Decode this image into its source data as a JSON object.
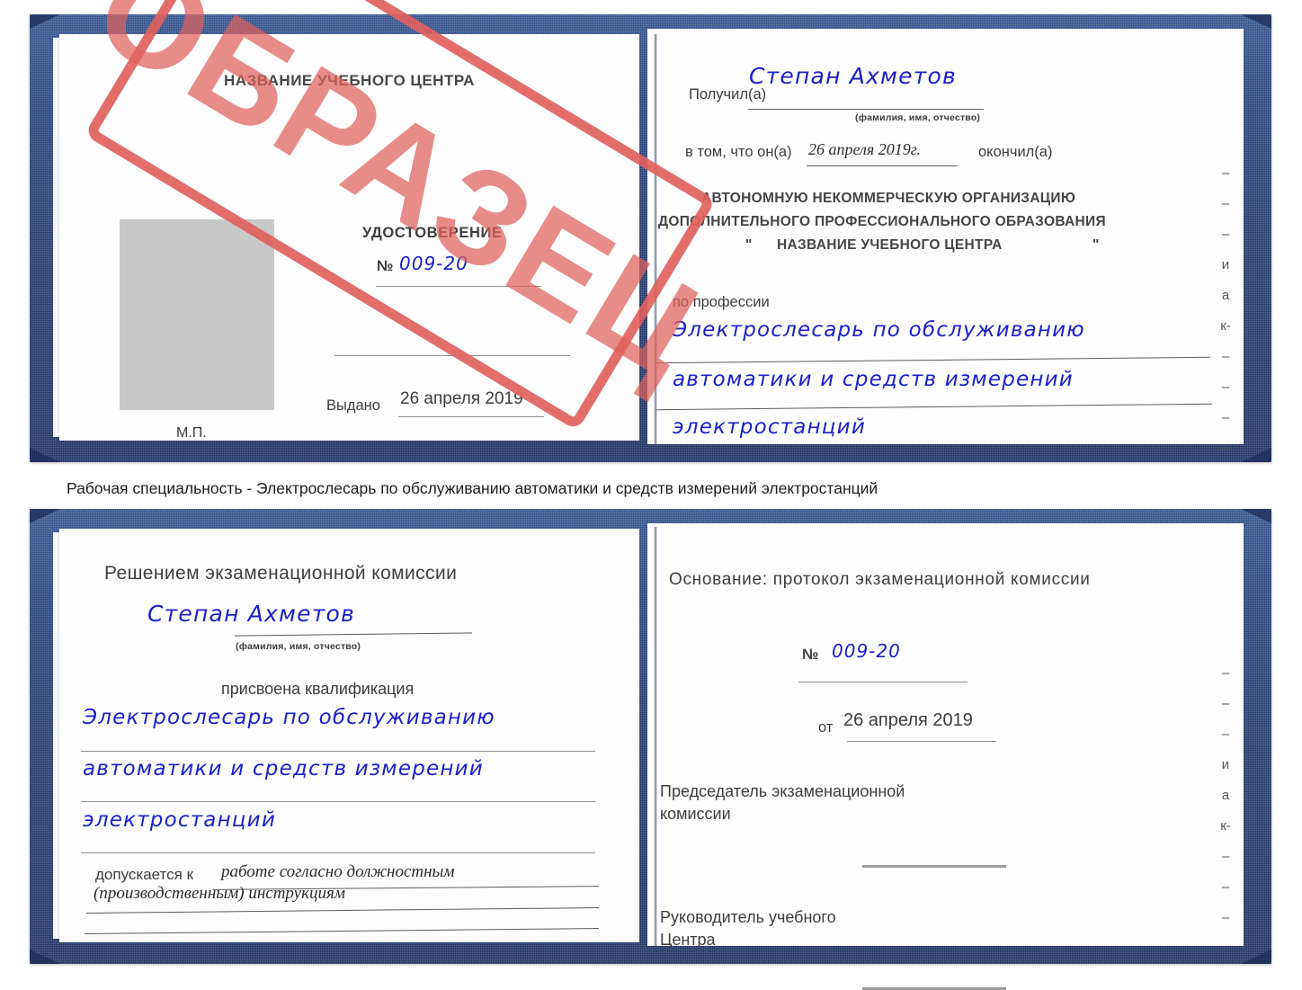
{
  "colors": {
    "cover_blue": "#2d4a86",
    "stamp_red": "#e0615d",
    "handwriting_blue": "#1b21c9",
    "photo_placeholder_gray": "#c9c9c9"
  },
  "caption": {
    "text": "Рабочая специальность - Электрослесарь по обслуживанию автоматики и средств измерений электростанций"
  },
  "watermark": {
    "text": "ОБРАЗЕЦ"
  },
  "certificate_top": {
    "left_page": {
      "org_title": "НАЗВАНИЕ УЧЕБНОГО ЦЕНТРА",
      "doc_title": "УДОСТОВЕРЕНИЕ",
      "number_label": "№",
      "number_value": "009-20",
      "issued_label": "Выдано",
      "issued_value": "26 апреля 2019",
      "seal_label": "М.П."
    },
    "right_page": {
      "received_label": "Получил(а)",
      "received_value": "Степан Ахметов",
      "name_hint": "(фамилия, имя, отчество)",
      "that_he_label": "в том, что он(а)",
      "finish_date": "26 апреля 2019г.",
      "graduated_label": "окончил(а)",
      "org_line_1": "АВТОНОМНУЮ НЕКОММЕРЧЕСКУЮ ОРГАНИЗАЦИЮ",
      "org_line_2": "ДОПОЛНИТЕЛЬНОГО ПРОФЕССИОНАЛЬНОГО ОБРАЗОВАНИЯ",
      "org_quote_open": "\"",
      "org_line_3": "НАЗВАНИЕ УЧЕБНОГО ЦЕНТРА",
      "org_quote_close": "\"",
      "profession_label": "по профессии",
      "profession_line_1": "Электрослесарь по обслуживанию",
      "profession_line_2": "автоматики и средств измерений",
      "profession_line_3": "электростанций",
      "edge_marks": "–\n–\n–\nи\nа\nк-\n–\n–\n–\n–"
    }
  },
  "certificate_bottom": {
    "left_page": {
      "decision_title": "Решением экзаменационной комиссии",
      "name_value": "Степан Ахметов",
      "name_hint": "(фамилия, имя, отчество)",
      "qualification_label": "присвоена квалификация",
      "qualification_line_1": "Электрослесарь по обслуживанию",
      "qualification_line_2": "автоматики и средств измерений",
      "qualification_line_3": "электростанций",
      "allowed_label": "допускается к",
      "allowed_value_1": "работе согласно должностным",
      "allowed_value_2": "(производственным) инструкциям"
    },
    "right_page": {
      "basis_label": "Основание: протокол экзаменационной комиссии",
      "number_label": "№",
      "number_value": "009-20",
      "date_label": "от",
      "date_value": "26 апреля 2019",
      "chairman_line_1": "Председатель экзаменационной",
      "chairman_line_2": "комиссии",
      "head_line_1": "Руководитель учебного",
      "head_line_2": "Центра",
      "edge_marks": "–\n–\n–\nи\nа\nк-\n–\n–\n–\n–"
    }
  }
}
